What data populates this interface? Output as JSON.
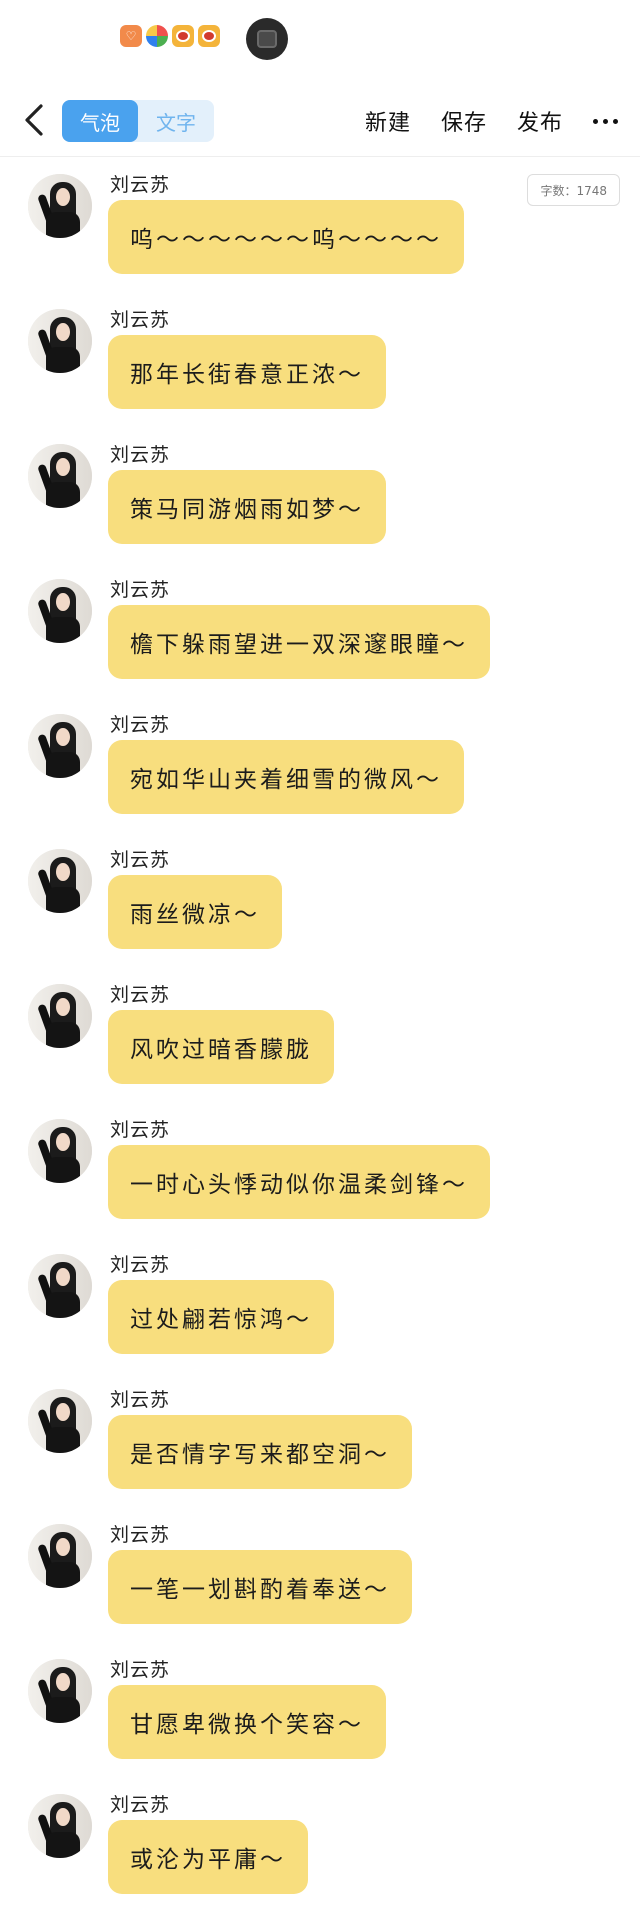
{
  "status_bar": {
    "icons": [
      "app-notification-icon",
      "pinwheel-app-icon",
      "weibo-icon",
      "weibo-icon"
    ]
  },
  "toolbar": {
    "tabs": [
      {
        "label": "气泡",
        "active": true
      },
      {
        "label": "文字",
        "active": false
      }
    ],
    "actions": {
      "new_label": "新建",
      "save_label": "保存",
      "publish_label": "发布"
    }
  },
  "word_count": "字数：1748",
  "colors": {
    "accent": "#4aa2ee",
    "bubble": "#f8de7e"
  },
  "messages": [
    {
      "sender": "刘云苏",
      "text": "呜～～～～～～呜～～～～"
    },
    {
      "sender": "刘云苏",
      "text": "那年长街春意正浓～"
    },
    {
      "sender": "刘云苏",
      "text": "策马同游烟雨如梦～"
    },
    {
      "sender": "刘云苏",
      "text": "檐下躲雨望进一双深邃眼瞳～"
    },
    {
      "sender": "刘云苏",
      "text": "宛如华山夹着细雪的微风～"
    },
    {
      "sender": "刘云苏",
      "text": "雨丝微凉～"
    },
    {
      "sender": "刘云苏",
      "text": "风吹过暗香朦胧"
    },
    {
      "sender": "刘云苏",
      "text": "一时心头悸动似你温柔剑锋～"
    },
    {
      "sender": "刘云苏",
      "text": "过处翩若惊鸿～"
    },
    {
      "sender": "刘云苏",
      "text": "是否情字写来都空洞～"
    },
    {
      "sender": "刘云苏",
      "text": "一笔一划斟酌着奉送～"
    },
    {
      "sender": "刘云苏",
      "text": "甘愿卑微换个笑容～"
    },
    {
      "sender": "刘云苏",
      "text": "或沦为平庸～"
    }
  ]
}
